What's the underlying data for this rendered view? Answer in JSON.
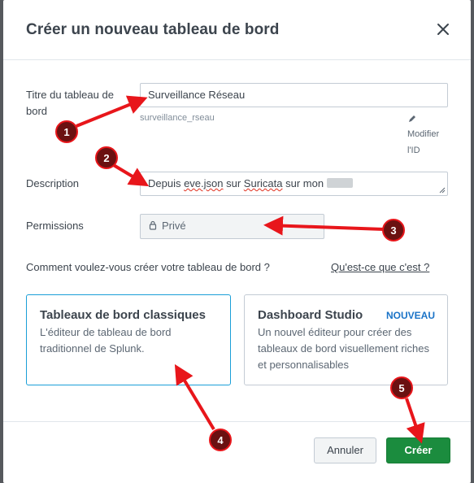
{
  "dialog": {
    "title": "Créer un nouveau tableau de bord"
  },
  "form": {
    "title_label_line1": "Titre du tableau de",
    "title_label_line2": "bord",
    "title_value": "Surveillance Réseau",
    "id_slug": "surveillance_rseau",
    "modify_id_line1": "Modifier",
    "modify_id_line2": "l'ID",
    "description_label": "Description",
    "description_prefix": "Depuis ",
    "description_flagged_1": "eve.json",
    "description_middle": " sur ",
    "description_flagged_2": "Suricata",
    "description_suffix": " sur mon",
    "permissions_label": "Permissions",
    "permissions_value": "Privé"
  },
  "creation": {
    "question": "Comment voulez-vous créer votre tableau de bord ?",
    "help_link": "Qu'est-ce que c'est ?",
    "options": [
      {
        "title": "Tableaux de bord classiques",
        "desc": "L'éditeur de tableau de bord traditionnel de Splunk.",
        "selected": true
      },
      {
        "title": "Dashboard Studio",
        "badge": "NOUVEAU",
        "desc": "Un nouvel éditeur pour créer des tableaux de bord visuellement riches et personnalisables",
        "selected": false
      }
    ]
  },
  "footer": {
    "cancel_label": "Annuler",
    "create_label": "Créer"
  },
  "annotations": {
    "markers": [
      "1",
      "2",
      "3",
      "4",
      "5"
    ],
    "color": "#e8161b",
    "marker_fill": "#6b1111"
  },
  "colors": {
    "primary_button": "#1b8c3e",
    "selected_card_border": "#1a9fd8",
    "badge": "#1a73c7"
  }
}
